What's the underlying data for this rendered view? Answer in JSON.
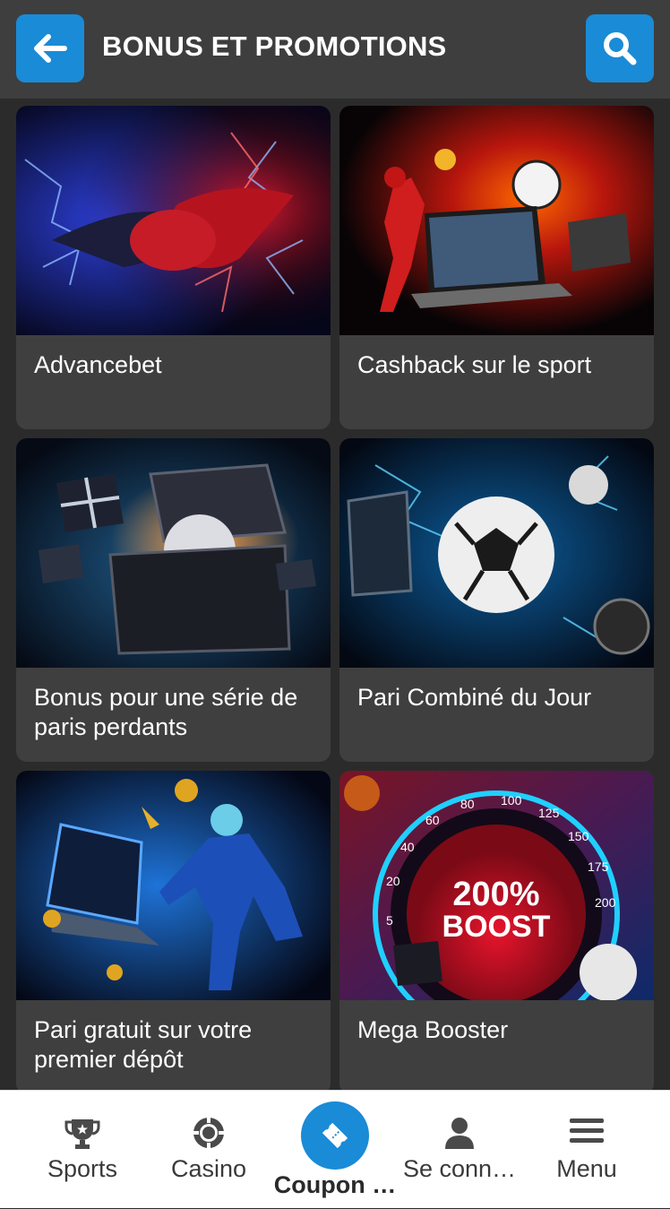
{
  "header": {
    "title": "BONUS ET PROMOTIONS",
    "back_icon": "arrow-left-icon",
    "search_icon": "search-icon",
    "accent": "#1a8bd6"
  },
  "promotions": [
    {
      "label": "Advancebet",
      "image": "handshake-lightning"
    },
    {
      "label": "Cashback sur le sport",
      "image": "football-laptop-fire"
    },
    {
      "label": "Bonus pour une série de paris perdants",
      "image": "gift-chest-ball"
    },
    {
      "label": "Pari Combiné du Jour",
      "image": "soccer-ball-electric"
    },
    {
      "label": "Pari gratuit sur votre premier dépôt",
      "image": "player-laptop-neon"
    },
    {
      "label": "Mega Booster",
      "image": "speedometer-200-boost"
    }
  ],
  "booster": {
    "gauge_text_1": "200%",
    "gauge_text_2": "BOOST",
    "ticks": [
      "5",
      "20",
      "40",
      "60",
      "80",
      "100",
      "125",
      "150",
      "175",
      "200"
    ]
  },
  "nav": {
    "sports": "Sports",
    "casino": "Casino",
    "coupon": "Coupon …",
    "login": "Se conn…",
    "menu": "Menu"
  }
}
